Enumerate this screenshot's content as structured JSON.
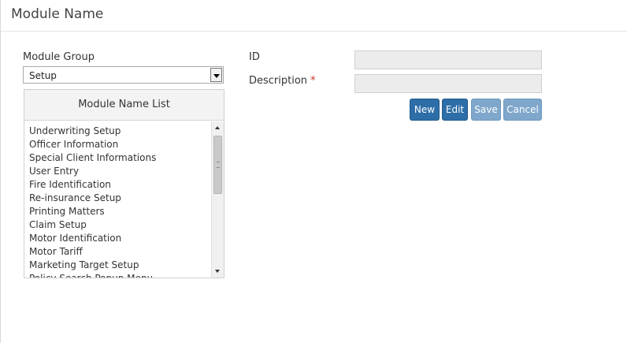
{
  "page": {
    "title": "Module Name"
  },
  "module_group": {
    "label": "Module Group",
    "selected": "Setup"
  },
  "module_list": {
    "header": "Module Name List",
    "items": [
      "Underwriting Setup",
      "Officer Information",
      "Special Client Informations",
      "User Entry",
      "Fire Identification",
      "Re-insurance Setup",
      "Printing Matters",
      "Claim Setup",
      "Motor Identification",
      "Motor Tariff",
      "Marketing Target Setup",
      "Policy Search Popup Menu"
    ]
  },
  "form": {
    "id_label": "ID",
    "id_value": "",
    "description_label": "Description",
    "description_required": "*",
    "description_value": ""
  },
  "buttons": {
    "new": "New",
    "edit": "Edit",
    "save": "Save",
    "cancel": "Cancel"
  },
  "colors": {
    "primary": "#2d6ea8",
    "disabled": "#7fa7cb",
    "required": "#c9302c"
  }
}
